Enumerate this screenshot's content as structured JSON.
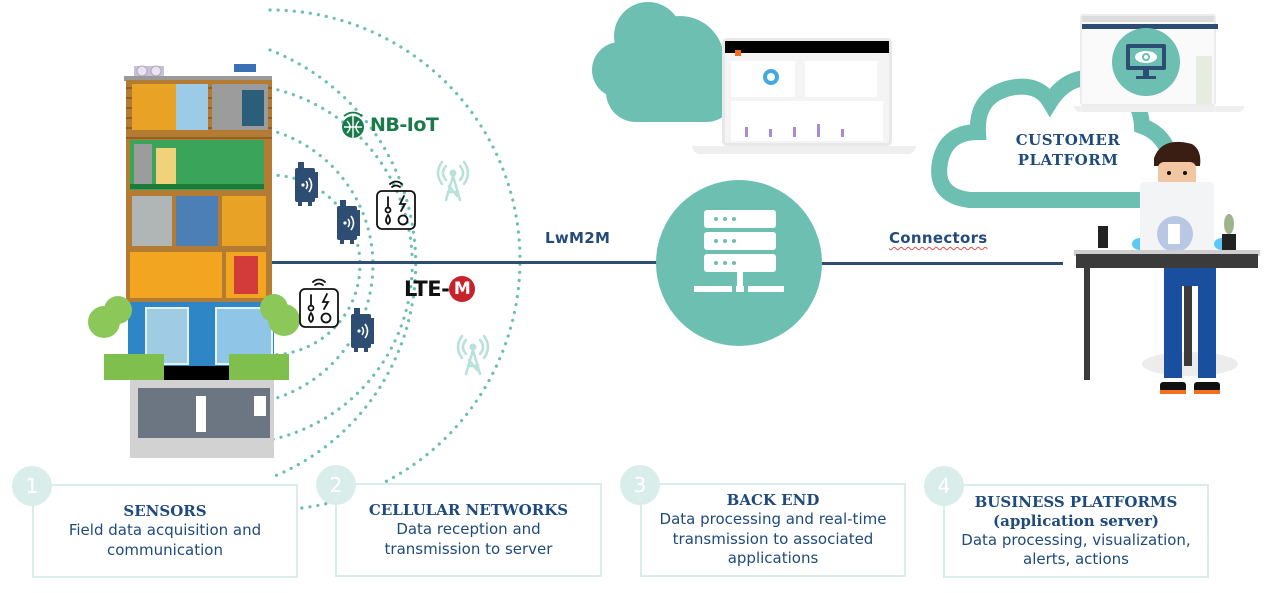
{
  "diagram": {
    "connections": {
      "sensor_to_backend_label": "LwM2M",
      "backend_to_platform_label": "Connectors"
    },
    "networks": {
      "nb_iot_label": "NB-IoT",
      "lte_m_prefix": "LTE-",
      "lte_m_badge": "M"
    },
    "customer_platform": {
      "line1": "CUSTOMER",
      "line2": "PLATFORM"
    },
    "colors": {
      "teal": "#6dbfb2",
      "navy": "#2d4e72",
      "step_teal_light": "#d9eeea",
      "text_blue": "#1f4a7c",
      "nb_iot_green": "#1a7a4c",
      "lte_red": "#c8232b"
    },
    "icons": {
      "server": "server-rack-icon",
      "monitor_eye": "monitor-eye-icon",
      "sensor": "iot-sensor-icon",
      "multi_sensor": "multi-sensor-icon",
      "antenna": "antenna-tower-icon",
      "cloud": "cloud-icon",
      "building": "smart-building-illustration",
      "person": "person-at-desk-illustration",
      "laptop": "laptop-dashboard-illustration"
    }
  },
  "steps": [
    {
      "number": "1",
      "title": "SENSORS",
      "title2": "",
      "desc": "Field data acquisition and communication"
    },
    {
      "number": "2",
      "title": "CELLULAR NETWORKS",
      "title2": "",
      "desc": "Data reception and transmission to server"
    },
    {
      "number": "3",
      "title": "BACK END",
      "title2": "",
      "desc": "Data processing and real-time transmission to associated applications"
    },
    {
      "number": "4",
      "title": "BUSINESS PLATFORMS",
      "title2": "(application server)",
      "desc": "Data processing, visualization, alerts, actions"
    }
  ]
}
